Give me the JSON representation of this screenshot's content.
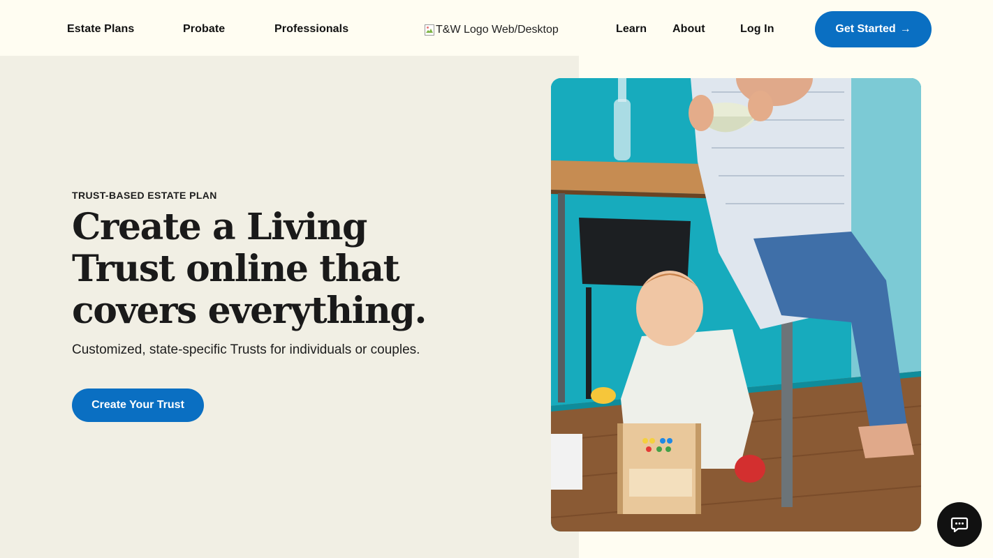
{
  "nav": {
    "items": [
      {
        "label": "Estate Plans"
      },
      {
        "label": "Probate"
      },
      {
        "label": "Professionals"
      }
    ],
    "logo_alt": "T&W Logo Web/Desktop",
    "right_items": [
      {
        "label": "Learn"
      },
      {
        "label": "About"
      },
      {
        "label": "Log In"
      }
    ],
    "cta": {
      "label": "Get Started",
      "arrow": "→"
    }
  },
  "hero": {
    "eyebrow": "TRUST-BASED ESTATE PLAN",
    "headline": "Create a Living Trust online that covers everything.",
    "subline": "Customized, state-specific Trusts for individuals or couples.",
    "button": "Create Your Trust"
  },
  "colors": {
    "accent": "#0a6fc2",
    "page_bg": "#fffdf2",
    "panel_bg": "#f1efe4",
    "photo_wall": "#1ab0c0"
  },
  "icons": {
    "chat": "chat-bubble-icon",
    "arrow": "arrow-right-icon",
    "broken_image": "broken-image-icon"
  }
}
